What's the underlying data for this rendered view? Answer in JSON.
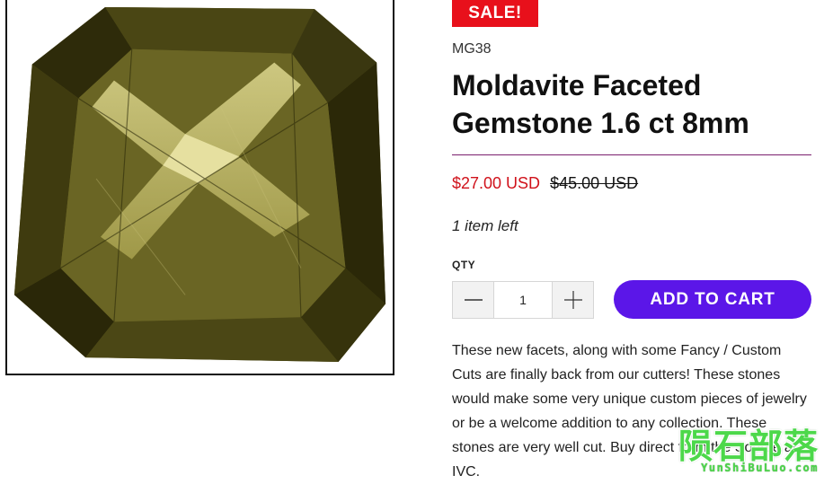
{
  "product": {
    "badge": "SALE!",
    "sku": "MG38",
    "title": "Moldavite Faceted Gemstone 1.6 ct 8mm",
    "price": "$27.00 USD",
    "compare_price": "$45.00 USD",
    "stock": "1 item left",
    "image_alt": "Moldavite faceted gemstone"
  },
  "quantity": {
    "label": "QTY",
    "value": "1"
  },
  "cart": {
    "add_label": "ADD TO CART"
  },
  "description": "These new facets, along with some Fancy / Custom Cuts are finally back from our cutters! These stones would make some very unique custom pieces of jewelry or be a welcome addition to any collection. These stones are very well cut. Buy direct from the Source at IVC.",
  "watermark": {
    "chinese": "陨石部落",
    "latin": "YunShiBuLuo.com"
  },
  "colors": {
    "sale": "#e8101b",
    "accent": "#5b16e8",
    "price": "#d0121b",
    "divider": "#7a1f6e"
  },
  "icons": [
    "minus-icon",
    "plus-icon"
  ]
}
